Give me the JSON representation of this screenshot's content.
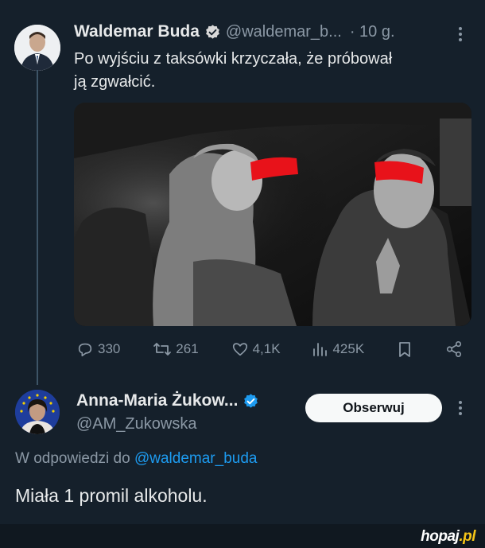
{
  "tweet": {
    "author_name": "Waldemar Buda",
    "handle": "@waldemar_b...",
    "time": "· 10 g.",
    "text_line1": "Po wyjściu z taksówki krzyczała, że próbował",
    "text_line2": "ją zgwałcić.",
    "stats": {
      "replies": "330",
      "reposts": "261",
      "likes": "4,1K",
      "views": "425K"
    }
  },
  "reply": {
    "author_name": "Anna-Maria Żukow...",
    "handle": "@AM_Zukowska",
    "follow_label": "Obserwuj",
    "reply_prefix": "W odpowiedzi do",
    "reply_mention": "@waldemar_buda",
    "text": "Miała 1 promil alkoholu."
  },
  "watermark": {
    "brand": "hopaj",
    "domain": ".pl"
  },
  "colors": {
    "background": "#15202b",
    "verified": "#1d9bf0",
    "secondary_text": "#8b98a5",
    "link": "#1d9bf0"
  },
  "icons": [
    "verified-badge-icon",
    "more-icon",
    "reply-icon",
    "repost-icon",
    "like-icon",
    "views-icon",
    "bookmark-icon",
    "share-icon",
    "eu-stars-icon"
  ]
}
